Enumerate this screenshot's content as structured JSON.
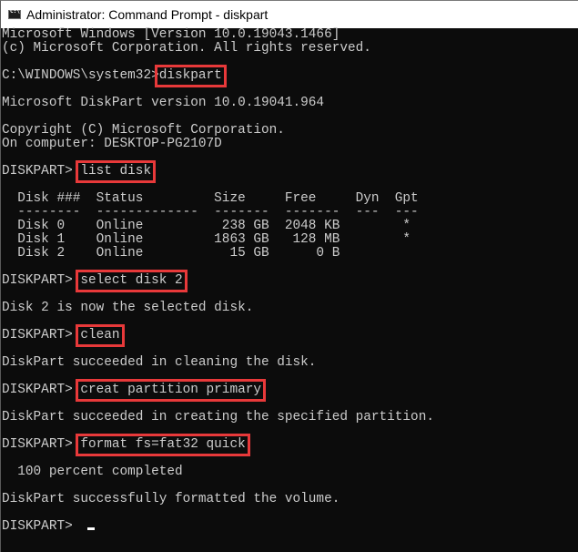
{
  "window": {
    "title": "Administrator: Command Prompt - diskpart",
    "icon": "cmd-icon"
  },
  "console": {
    "banner1": "Microsoft Windows [Version 10.0.19043.1466]",
    "banner2": "(c) Microsoft Corporation. All rights reserved.",
    "prompt1": "C:\\WINDOWS\\system32>",
    "cmd1": "diskpart",
    "dp_version": "Microsoft DiskPart version 10.0.19041.964",
    "copyright": "Copyright (C) Microsoft Corporation.",
    "computer": "On computer: DESKTOP-PG2107D",
    "prompt": "DISKPART> ",
    "cmd2": "list disk",
    "table": {
      "header": "  Disk ###  Status         Size     Free     Dyn  Gpt",
      "divider": "  --------  -------------  -------  -------  ---  ---",
      "rows": [
        "  Disk 0    Online          238 GB  2048 KB        *",
        "  Disk 1    Online         1863 GB   128 MB        *",
        "  Disk 2    Online           15 GB      0 B"
      ],
      "columns": [
        "Disk ###",
        "Status",
        "Size",
        "Free",
        "Dyn",
        "Gpt"
      ],
      "data": [
        {
          "disk": "Disk 0",
          "status": "Online",
          "size": "238 GB",
          "free": "2048 KB",
          "dyn": "",
          "gpt": "*"
        },
        {
          "disk": "Disk 1",
          "status": "Online",
          "size": "1863 GB",
          "free": "128 MB",
          "dyn": "",
          "gpt": "*"
        },
        {
          "disk": "Disk 2",
          "status": "Online",
          "size": "15 GB",
          "free": "0 B",
          "dyn": "",
          "gpt": ""
        }
      ]
    },
    "cmd3": "select disk 2",
    "out3": "Disk 2 is now the selected disk.",
    "cmd4": "clean",
    "out4": "DiskPart succeeded in cleaning the disk.",
    "cmd5": "creat partition primary",
    "out5": "DiskPart succeeded in creating the specified partition.",
    "cmd6": "format fs=fat32 quick",
    "out6a": "  100 percent completed",
    "out6b": "DiskPart successfully formatted the volume.",
    "highlight_color": "#e8393a"
  }
}
